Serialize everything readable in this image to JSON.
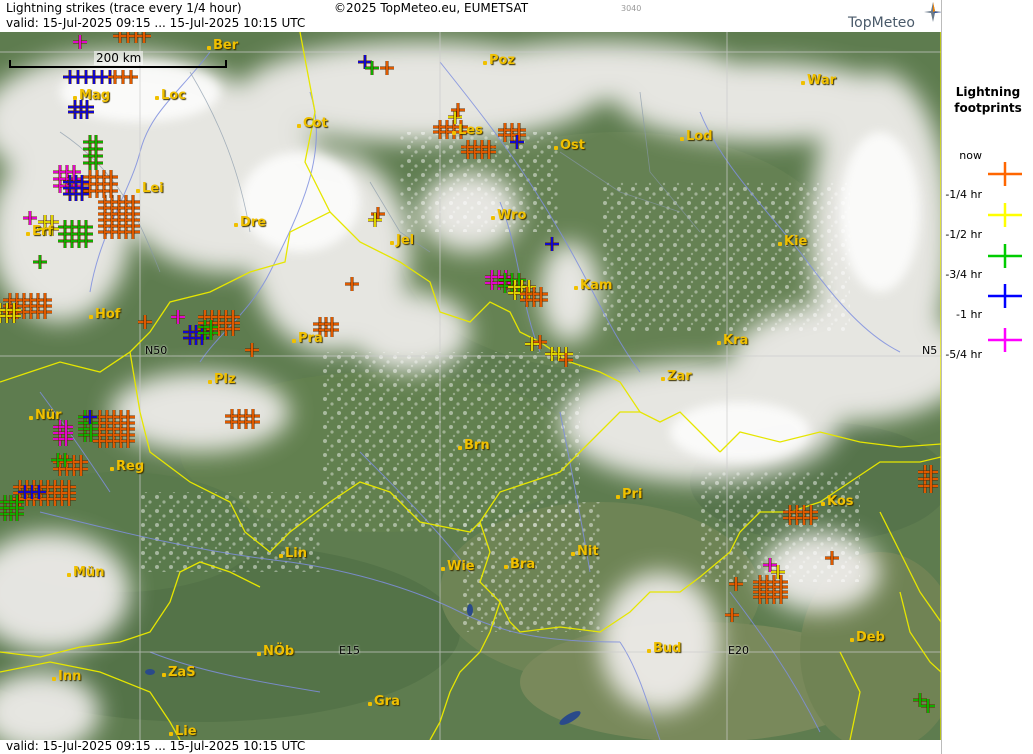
{
  "header": {
    "title": "Lightning strikes (trace every 1/4 hour)",
    "valid": "valid:  15-Jul-2025 09:15 ... 15-Jul-2025 10:15 UTC",
    "copyright": "©2025 TopMeteo.eu, EUMETSAT",
    "code": "3040",
    "logo": "TopMeteo"
  },
  "footer": {
    "valid": "valid:  15-Jul-2025 09:15 ... 15-Jul-2025 10:15 UTC"
  },
  "map": {
    "scalebar": "200 km",
    "grid_labels": [
      "N50",
      "N5",
      "E15",
      "E20"
    ],
    "cities": [
      "Ber",
      "Poz",
      "War",
      "Mag",
      "Loc",
      "Cot",
      "Les",
      "Ost",
      "Lod",
      "Lei",
      "Wro",
      "Dre",
      "Erf",
      "Jel",
      "Kie",
      "Kam",
      "Hof",
      "Pra",
      "Kra",
      "Plz",
      "Zar",
      "Nür",
      "Brn",
      "Reg",
      "Pri",
      "Kos",
      "Lin",
      "Nit",
      "Wie",
      "Bra",
      "Mün",
      "Bud",
      "Deb",
      "Inn",
      "ZaS",
      "NÖb",
      "Gra",
      "Lie"
    ],
    "colors": {
      "now": "#ff6600",
      "q1": "#ffff00",
      "q2": "#00cc00",
      "q3": "#0000ff",
      "q4": "#ff00ff",
      "border": "#e6e600",
      "river": "#7f8fdf"
    }
  },
  "legend": {
    "title": "Lightning footprints",
    "items": [
      {
        "label": "now",
        "color": "#ff6600"
      },
      {
        "label": "-1/4 hr",
        "color": "#ffff00"
      },
      {
        "label": "-1/2 hr",
        "color": "#00cc00"
      },
      {
        "label": "-3/4 hr",
        "color": "#0000ff"
      },
      {
        "label": "-1 hr",
        "color": "#ff00ff"
      },
      {
        "label": "-5/4 hr",
        "color": ""
      }
    ]
  }
}
